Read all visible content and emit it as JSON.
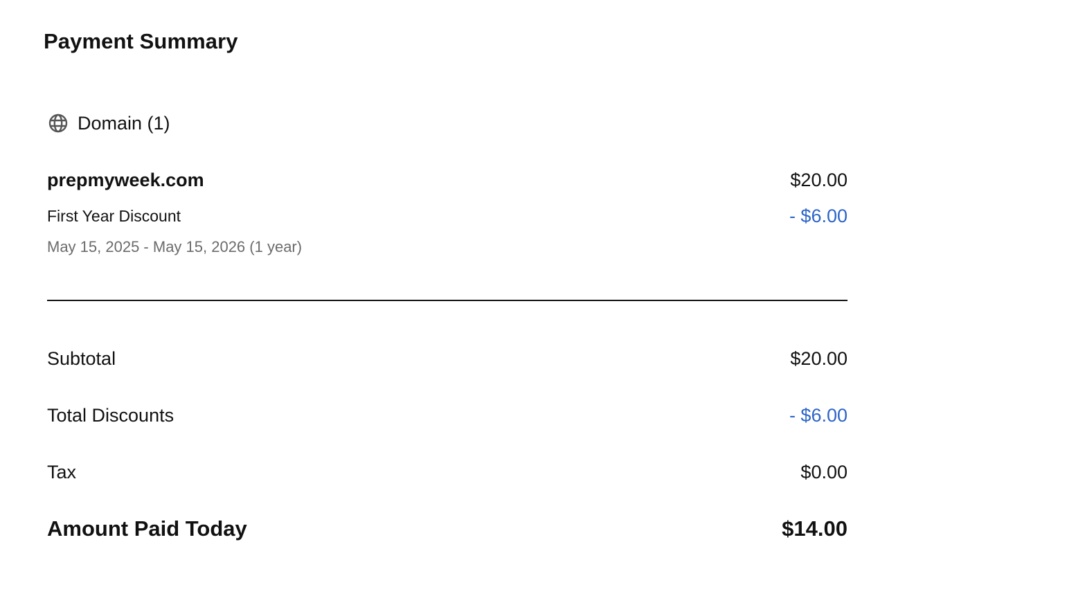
{
  "title": "Payment Summary",
  "section": {
    "icon": "globe-icon",
    "label": "Domain (1)"
  },
  "item": {
    "name": "prepmyweek.com",
    "price": "$20.00",
    "discount_label": "First Year Discount",
    "discount_value": "- $6.00",
    "period": "May 15, 2025 - May 15, 2026 (1 year)"
  },
  "summary": {
    "subtotal_label": "Subtotal",
    "subtotal_value": "$20.00",
    "discounts_label": "Total Discounts",
    "discounts_value": "- $6.00",
    "tax_label": "Tax",
    "tax_value": "$0.00",
    "total_label": "Amount Paid Today",
    "total_value": "$14.00"
  },
  "colors": {
    "discount": "#2d64c9",
    "text": "#111111",
    "muted": "#6b6b6b"
  }
}
